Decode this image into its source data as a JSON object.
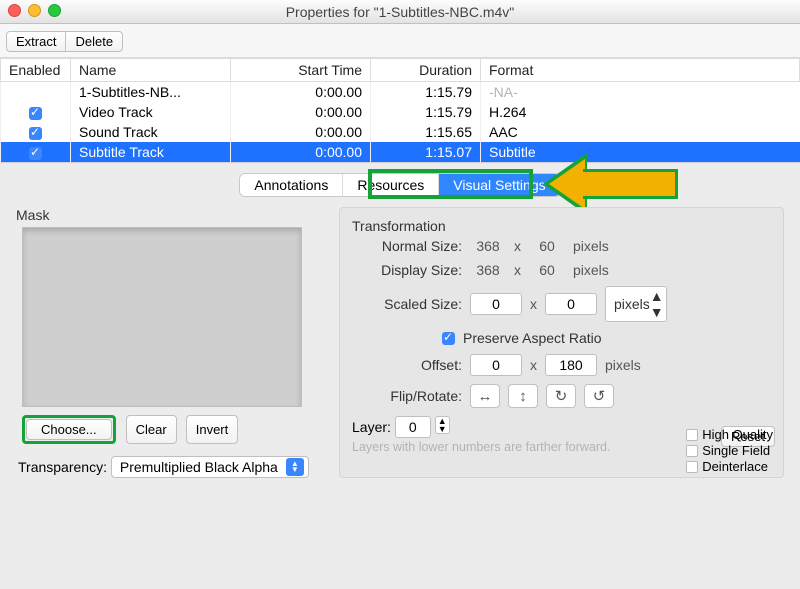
{
  "window": {
    "title": "Properties for \"1-Subtitles-NBC.m4v\""
  },
  "traffic": {
    "close": "#ff5f57",
    "min": "#ffbd2e",
    "max": "#28c940"
  },
  "toolbar": {
    "extract": "Extract",
    "delete": "Delete"
  },
  "table": {
    "headers": {
      "enabled": "Enabled",
      "name": "Name",
      "start": "Start Time",
      "duration": "Duration",
      "format": "Format"
    },
    "rows": [
      {
        "enabled": false,
        "name": "1-Subtitles-NB...",
        "start": "0:00.00",
        "duration": "1:15.79",
        "format": "-NA-"
      },
      {
        "enabled": true,
        "name": "Video Track",
        "start": "0:00.00",
        "duration": "1:15.79",
        "format": "H.264"
      },
      {
        "enabled": true,
        "name": "Sound Track",
        "start": "0:00.00",
        "duration": "1:15.65",
        "format": "AAC"
      },
      {
        "enabled": true,
        "name": "Subtitle Track",
        "start": "0:00.00",
        "duration": "1:15.07",
        "format": "Subtitle",
        "selected": true
      }
    ]
  },
  "tabs": {
    "ann": "Annotations",
    "res": "Resources",
    "vis": "Visual Settings"
  },
  "mask": {
    "label": "Mask",
    "choose": "Choose...",
    "clear": "Clear",
    "invert": "Invert",
    "transparency_label": "Transparency:",
    "transparency_value": "Premultiplied Black Alpha"
  },
  "trans": {
    "label": "Transformation",
    "normal": "Normal Size:",
    "display": "Display Size:",
    "scaled": "Scaled Size:",
    "nw": "368",
    "nh": "60",
    "dw": "368",
    "dh": "60",
    "sw": "0",
    "sh": "0",
    "unit": "pixels",
    "preserve": "Preserve Aspect Ratio",
    "offset": "Offset:",
    "ox": "0",
    "oy": "180",
    "flip": "Flip/Rotate:",
    "reset": "Reset",
    "layer_label": "Layer:",
    "layer_val": "0",
    "hint": "Layers with lower numbers are farther forward.",
    "hq": "High Quality",
    "sf": "Single Field",
    "de": "Deinterlace",
    "x": "x",
    "pixels": "pixels"
  }
}
